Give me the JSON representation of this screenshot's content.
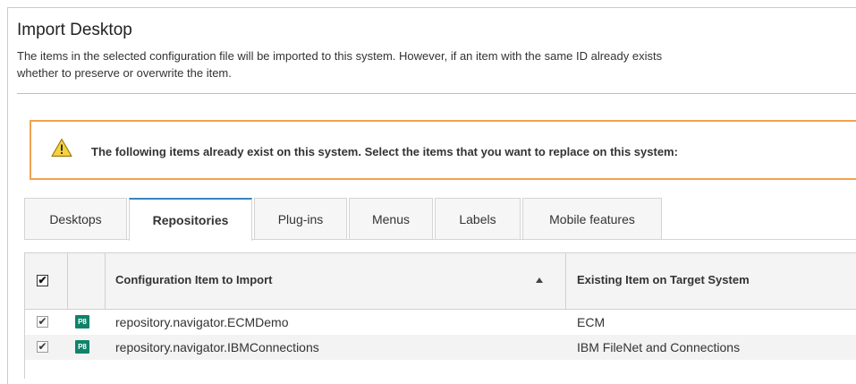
{
  "dialog": {
    "title": "Import Desktop",
    "description_line1": "The items in the selected configuration file will be imported to this system. However, if an item with the same ID already exists",
    "description_line2": "whether to preserve or overwrite the item."
  },
  "warning": {
    "icon": "warning-triangle-icon",
    "text": "The following items already exist on this system. Select the items that you want to replace on this system:",
    "border_color": "#f0a34f"
  },
  "tabs": [
    {
      "label": "Desktops",
      "active": false
    },
    {
      "label": "Repositories",
      "active": true
    },
    {
      "label": "Plug-ins",
      "active": false
    },
    {
      "label": "Menus",
      "active": false
    },
    {
      "label": "Labels",
      "active": false
    },
    {
      "label": "Mobile features",
      "active": false
    }
  ],
  "table": {
    "select_all_checked": true,
    "select_all_mark": "✔",
    "columns": [
      "Configuration Item to Import",
      "Existing Item on Target System"
    ],
    "sort_column": "Configuration Item to Import",
    "sort_direction": "ascending",
    "rows": [
      {
        "checked": true,
        "mark": "✔",
        "badge": "P8",
        "item": "repository.navigator.ECMDemo",
        "existing": "ECM"
      },
      {
        "checked": true,
        "mark": "✔",
        "badge": "P8",
        "item": "repository.navigator.IBMConnections",
        "existing": "IBM FileNet and Connections"
      }
    ]
  },
  "colors": {
    "accent_tab": "#3b83c4",
    "badge": "#10836a"
  }
}
